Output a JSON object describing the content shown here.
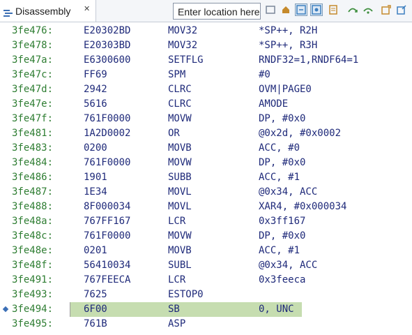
{
  "tab": {
    "label": "Disassembly",
    "close_glyph": "✕",
    "icon": "disassembly-icon"
  },
  "location": {
    "placeholder": "Enter location here"
  },
  "toolbar": [
    {
      "name": "refresh-button",
      "icon": "refresh-icon",
      "color": "#7a8699"
    },
    {
      "name": "home-button",
      "icon": "home-icon",
      "color": "#c58a2c"
    },
    {
      "name": "sync-button",
      "icon": "sync-icon",
      "color": "#3d7fbf"
    },
    {
      "name": "link-with-debug-button",
      "icon": "link-icon",
      "color": "#3d7fbf"
    },
    {
      "name": "source-lookup-button",
      "icon": "source-icon",
      "color": "#c58a2c"
    },
    {
      "name": "step-over-button",
      "icon": "step-icon",
      "color": "#3f8f3f"
    },
    {
      "name": "step-return-button",
      "icon": "step-return-icon",
      "color": "#3f8f3f"
    },
    {
      "name": "new-view-button",
      "icon": "new-view-icon",
      "color": "#c58a2c"
    },
    {
      "name": "pin-button",
      "icon": "pin-icon",
      "color": "#3d7fbf"
    }
  ],
  "current_address": "3fe494:",
  "rows": [
    {
      "addr": "3fe476:",
      "bytes": "E20302BD",
      "mnem": "MOV32",
      "ops": "*SP++, R2H"
    },
    {
      "addr": "3fe478:",
      "bytes": "E20303BD",
      "mnem": "MOV32",
      "ops": "*SP++, R3H"
    },
    {
      "addr": "3fe47a:",
      "bytes": "E6300600",
      "mnem": "SETFLG",
      "ops": "RNDF32=1,RNDF64=1"
    },
    {
      "addr": "3fe47c:",
      "bytes": "FF69",
      "mnem": "SPM",
      "ops": "#0"
    },
    {
      "addr": "3fe47d:",
      "bytes": "2942",
      "mnem": "CLRC",
      "ops": "OVM|PAGE0"
    },
    {
      "addr": "3fe47e:",
      "bytes": "5616",
      "mnem": "CLRC",
      "ops": "AMODE"
    },
    {
      "addr": "3fe47f:",
      "bytes": "761F0000",
      "mnem": "MOVW",
      "ops": "DP, #0x0"
    },
    {
      "addr": "3fe481:",
      "bytes": "1A2D0002",
      "mnem": "OR",
      "ops": "@0x2d, #0x0002"
    },
    {
      "addr": "3fe483:",
      "bytes": "0200",
      "mnem": "MOVB",
      "ops": "ACC, #0"
    },
    {
      "addr": "3fe484:",
      "bytes": "761F0000",
      "mnem": "MOVW",
      "ops": "DP, #0x0"
    },
    {
      "addr": "3fe486:",
      "bytes": "1901",
      "mnem": "SUBB",
      "ops": "ACC, #1"
    },
    {
      "addr": "3fe487:",
      "bytes": "1E34",
      "mnem": "MOVL",
      "ops": "@0x34, ACC"
    },
    {
      "addr": "3fe488:",
      "bytes": "8F000034",
      "mnem": "MOVL",
      "ops": "XAR4, #0x000034"
    },
    {
      "addr": "3fe48a:",
      "bytes": "767FF167",
      "mnem": "LCR",
      "ops": "0x3ff167"
    },
    {
      "addr": "3fe48c:",
      "bytes": "761F0000",
      "mnem": "MOVW",
      "ops": "DP, #0x0"
    },
    {
      "addr": "3fe48e:",
      "bytes": "0201",
      "mnem": "MOVB",
      "ops": "ACC, #1"
    },
    {
      "addr": "3fe48f:",
      "bytes": "56410034",
      "mnem": "SUBL",
      "ops": "@0x34, ACC"
    },
    {
      "addr": "3fe491:",
      "bytes": "767FEECA",
      "mnem": "LCR",
      "ops": "0x3feeca"
    },
    {
      "addr": "3fe493:",
      "bytes": "7625",
      "mnem": "ESTOP0",
      "ops": ""
    },
    {
      "addr": "3fe494:",
      "bytes": "6F00",
      "mnem": "SB",
      "ops": "0, UNC"
    },
    {
      "addr": "3fe495:",
      "bytes": "761B",
      "mnem": "ASP",
      "ops": ""
    }
  ],
  "colors": {
    "address": "#2e7d32",
    "code": "#1f2a7a",
    "current_line": "#c6ddb0",
    "pc_marker": "#3b6fb6"
  }
}
